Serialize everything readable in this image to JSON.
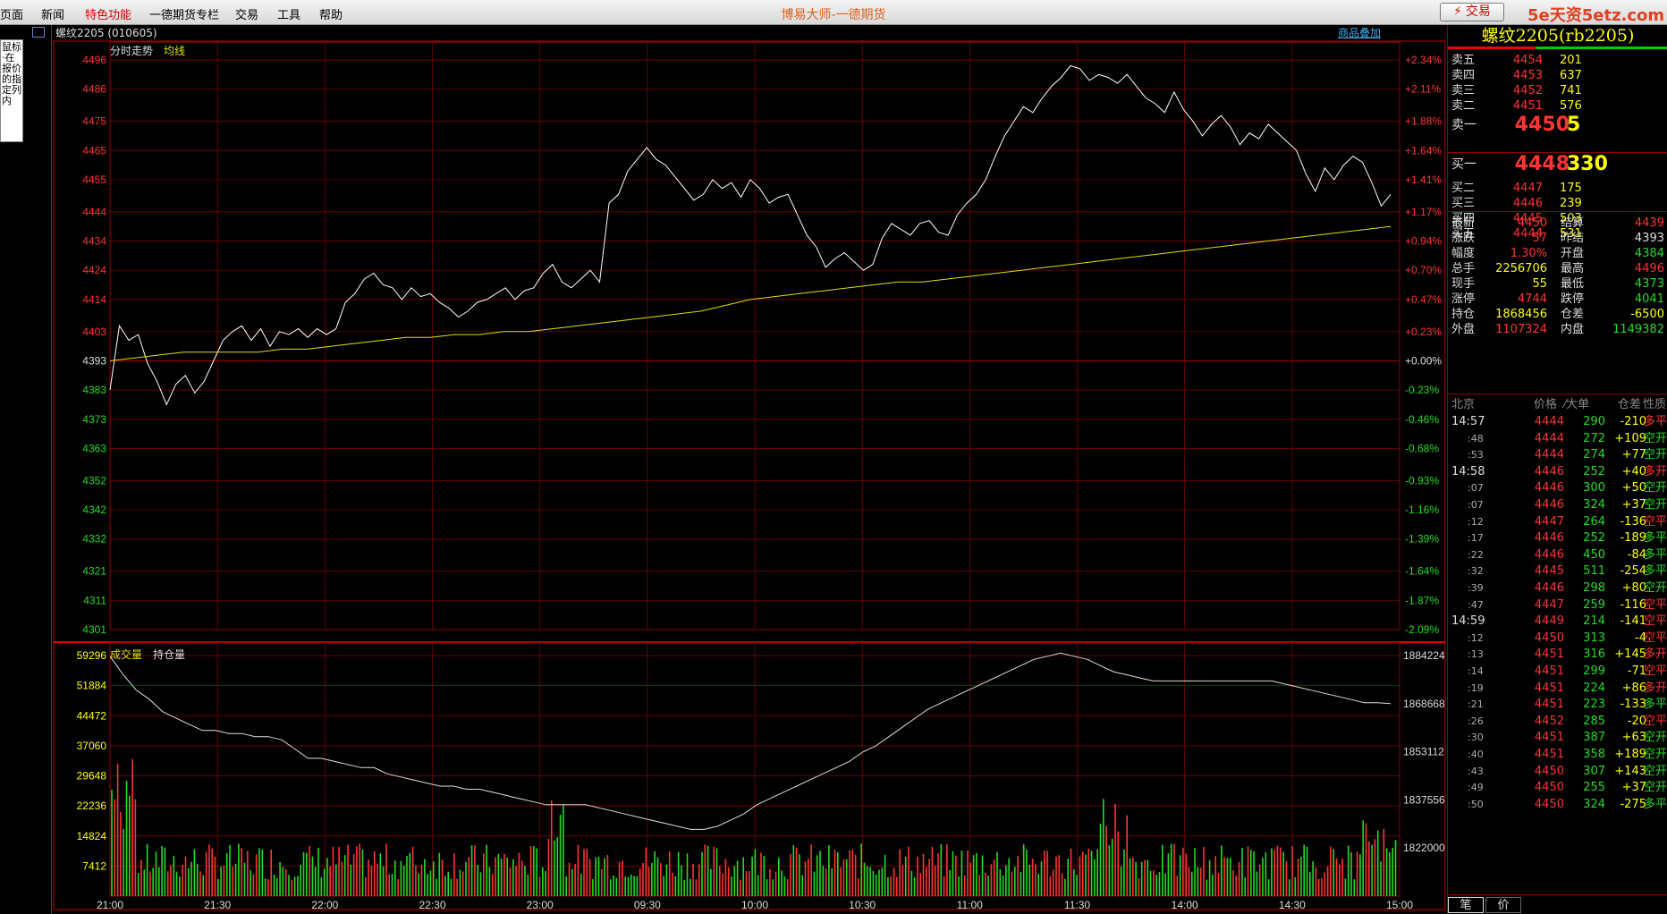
{
  "menu": [
    "页面",
    "新闻",
    "特色功能",
    "一德期货专栏",
    "交易",
    "工具",
    "帮助"
  ],
  "app_title": "博易大师-一德期货",
  "trade_button": "交易",
  "watermark": "5e天资5etz.com",
  "left_note": "鼠标·在报价的指定列内",
  "info": {
    "code": "螺纹2205 (010605)",
    "overlay_link": "商品叠加"
  },
  "upper_legend": {
    "a": "分时走势",
    "b": "均线"
  },
  "lower_legend": {
    "a": "成交量",
    "b": "持仓量"
  },
  "colors": {
    "up": "#ff3333",
    "down": "#22dd22",
    "flat": "#dddddd",
    "avg_line": "#e0e000",
    "grid": "#8a0000",
    "price_line": "#ffffff"
  },
  "chart_data": [
    {
      "type": "line",
      "title": "分时走势",
      "y_ticks": [
        4496,
        4486,
        4475,
        4465,
        4455,
        4444,
        4434,
        4424,
        4414,
        4403,
        4393,
        4383,
        4373,
        4363,
        4352,
        4342,
        4332,
        4321,
        4311,
        4301
      ],
      "pct_ticks": [
        "+2.34%",
        "+2.11%",
        "+1.88%",
        "+1.64%",
        "+1.41%",
        "+1.17%",
        "+0.94%",
        "+0.70%",
        "+0.47%",
        "+0.23%",
        "+0.00%",
        "-0.23%",
        "-0.46%",
        "-0.68%",
        "-0.93%",
        "-1.16%",
        "-1.39%",
        "-1.64%",
        "-1.87%",
        "-2.09%"
      ],
      "ylim": [
        4301,
        4496
      ],
      "base": 4393,
      "x_ticks": [
        "21:00",
        "21:30",
        "22:00",
        "22:30",
        "23:00",
        "09:30",
        "10:00",
        "10:30",
        "11:00",
        "11:30",
        "14:00",
        "14:30",
        "15:00"
      ],
      "series": [
        {
          "name": "分时走势",
          "values": [
            4383,
            4405,
            4400,
            4402,
            4392,
            4386,
            4378,
            4385,
            4388,
            4382,
            4386,
            4393,
            4400,
            4403,
            4405,
            4400,
            4404,
            4398,
            4403,
            4402,
            4404,
            4401,
            4404,
            4402,
            4404,
            4413,
            4416,
            4421,
            4423,
            4419,
            4418,
            4414,
            4418,
            4415,
            4416,
            4413,
            4411,
            4408,
            4410,
            4413,
            4414,
            4416,
            4418,
            4414,
            4417,
            4418,
            4423,
            4426,
            4420,
            4418,
            4421,
            4424,
            4420,
            4447,
            4450,
            4458,
            4462,
            4466,
            4462,
            4460,
            4456,
            4452,
            4448,
            4450,
            4455,
            4452,
            4454,
            4449,
            4455,
            4452,
            4447,
            4449,
            4450,
            4443,
            4436,
            4432,
            4425,
            4428,
            4430,
            4427,
            4424,
            4426,
            4435,
            4440,
            4438,
            4436,
            4440,
            4441,
            4437,
            4436,
            4443,
            4447,
            4450,
            4455,
            4463,
            4470,
            4475,
            4480,
            4478,
            4483,
            4487,
            4490,
            4494,
            4493,
            4489,
            4491,
            4490,
            4488,
            4491,
            4487,
            4483,
            4481,
            4478,
            4485,
            4479,
            4475,
            4470,
            4474,
            4477,
            4473,
            4467,
            4471,
            4469,
            4474,
            4471,
            4468,
            4465,
            4457,
            4451,
            4459,
            4455,
            4460,
            4463,
            4461,
            4454,
            4446,
            4450
          ]
        },
        {
          "name": "均线",
          "values": [
            4393,
            4394,
            4395,
            4396,
            4396,
            4396,
            4396,
            4397,
            4397,
            4398,
            4399,
            4400,
            4401,
            4401,
            4402,
            4402,
            4403,
            4403,
            4404,
            4405,
            4406,
            4407,
            4408,
            4409,
            4410,
            4412,
            4414,
            4415,
            4416,
            4417,
            4418,
            4419,
            4420,
            4420,
            4421,
            4422,
            4423,
            4424,
            4425,
            4426,
            4427,
            4428,
            4429,
            4430,
            4431,
            4432,
            4433,
            4434,
            4435,
            4436,
            4437,
            4438,
            4439
          ]
        }
      ]
    },
    {
      "type": "bar",
      "title": "成交量",
      "y_ticks_left": [
        59296,
        51884,
        44472,
        37060,
        29648,
        22236,
        14824,
        7412
      ],
      "y_ticks_right": [
        1884224,
        1868668,
        1853112,
        1837556,
        1822000
      ],
      "ylim_left": [
        0,
        59296
      ],
      "series": [
        {
          "name": "持仓量",
          "values": [
            1884000,
            1878000,
            1873000,
            1870000,
            1866000,
            1864000,
            1862000,
            1860000,
            1860000,
            1859000,
            1859000,
            1858000,
            1858000,
            1857000,
            1854000,
            1851000,
            1851000,
            1850000,
            1849000,
            1848000,
            1848000,
            1846000,
            1845000,
            1844000,
            1843000,
            1842000,
            1842000,
            1841000,
            1841000,
            1840000,
            1839000,
            1838000,
            1837000,
            1836000,
            1836000,
            1836000,
            1836000,
            1835000,
            1834000,
            1833000,
            1832000,
            1831000,
            1830000,
            1829000,
            1828000,
            1828000,
            1829000,
            1831000,
            1833000,
            1836000,
            1838000,
            1840000,
            1842000,
            1844000,
            1846000,
            1848000,
            1850000,
            1853000,
            1855000,
            1858000,
            1861000,
            1864000,
            1867000,
            1869000,
            1871000,
            1873000,
            1875000,
            1877000,
            1879000,
            1881000,
            1883000,
            1884000,
            1885000,
            1884000,
            1883000,
            1881000,
            1879000,
            1878000,
            1877000,
            1876000,
            1876000,
            1876000,
            1876000,
            1876000,
            1876000,
            1876000,
            1876000,
            1876000,
            1876000,
            1875000,
            1874000,
            1873000,
            1872000,
            1871000,
            1870000,
            1869000,
            1869000,
            1868668
          ]
        }
      ]
    }
  ],
  "quote": {
    "title": "螺纹2205(rb2205)",
    "asks": [
      {
        "label": "卖五",
        "price": "4454",
        "vol": "201"
      },
      {
        "label": "卖四",
        "price": "4453",
        "vol": "637"
      },
      {
        "label": "卖三",
        "price": "4452",
        "vol": "741"
      },
      {
        "label": "卖二",
        "price": "4451",
        "vol": "576"
      },
      {
        "label": "卖一",
        "price": "4450",
        "vol": "5"
      }
    ],
    "bids": [
      {
        "label": "买一",
        "price": "4448",
        "vol": "330"
      },
      {
        "label": "买二",
        "price": "4447",
        "vol": "175"
      },
      {
        "label": "买三",
        "price": "4446",
        "vol": "239"
      },
      {
        "label": "买四",
        "price": "4445",
        "vol": "503"
      },
      {
        "label": "买五",
        "price": "4444",
        "vol": "531"
      }
    ],
    "stats": [
      {
        "l1": "最新",
        "v1": "4450",
        "c1": "red",
        "l2": "结算",
        "v2": "4439",
        "c2": "red"
      },
      {
        "l1": "涨跌",
        "v1": "57",
        "c1": "red",
        "l2": "昨结",
        "v2": "4393",
        "c2": "white"
      },
      {
        "l1": "幅度",
        "v1": "1.30%",
        "c1": "red",
        "l2": "开盘",
        "v2": "4384",
        "c2": "green"
      },
      {
        "l1": "总手",
        "v1": "2256706",
        "c1": "yellow",
        "l2": "最高",
        "v2": "4496",
        "c2": "red"
      },
      {
        "l1": "现手",
        "v1": "55",
        "c1": "yellow",
        "l2": "最低",
        "v2": "4373",
        "c2": "green"
      },
      {
        "l1": "涨停",
        "v1": "4744",
        "c1": "red",
        "l2": "跌停",
        "v2": "4041",
        "c2": "green"
      },
      {
        "l1": "持仓",
        "v1": "1868456",
        "c1": "yellow",
        "l2": "仓差",
        "v2": "-6500",
        "c2": "yellow"
      },
      {
        "l1": "外盘",
        "v1": "1107324",
        "c1": "red",
        "l2": "内盘",
        "v2": "1149382",
        "c2": "green"
      }
    ],
    "tick_header": {
      "time": "北京",
      "price": "价格",
      "vol": "⁄大单",
      "oi": "仓差",
      "type": "性质"
    },
    "ticks": [
      {
        "t": "14:57",
        "sub": false,
        "p": "4444",
        "v": "290",
        "oi": "-210",
        "type": "多平",
        "tc": "red"
      },
      {
        "t": ":48",
        "sub": true,
        "p": "4444",
        "v": "272",
        "oi": "+109",
        "type": "空开",
        "tc": "green"
      },
      {
        "t": ":53",
        "sub": true,
        "p": "4444",
        "v": "274",
        "oi": "+77",
        "type": "空开",
        "tc": "green"
      },
      {
        "t": "14:58",
        "sub": false,
        "p": "4446",
        "v": "252",
        "oi": "+40",
        "type": "多开",
        "tc": "red"
      },
      {
        "t": ":07",
        "sub": true,
        "p": "4446",
        "v": "300",
        "oi": "+50",
        "type": "空开",
        "tc": "green"
      },
      {
        "t": ":07",
        "sub": true,
        "p": "4446",
        "v": "324",
        "oi": "+37",
        "type": "空开",
        "tc": "green"
      },
      {
        "t": ":12",
        "sub": true,
        "p": "4447",
        "v": "264",
        "oi": "-136",
        "type": "空平",
        "tc": "red"
      },
      {
        "t": ":17",
        "sub": true,
        "p": "4446",
        "v": "252",
        "oi": "-189",
        "type": "多平",
        "tc": "green"
      },
      {
        "t": ":22",
        "sub": true,
        "p": "4446",
        "v": "450",
        "oi": "-84",
        "type": "多平",
        "tc": "green"
      },
      {
        "t": ":32",
        "sub": true,
        "p": "4445",
        "v": "511",
        "oi": "-254",
        "type": "多平",
        "tc": "green"
      },
      {
        "t": ":39",
        "sub": true,
        "p": "4446",
        "v": "298",
        "oi": "+80",
        "type": "空开",
        "tc": "green"
      },
      {
        "t": ":47",
        "sub": true,
        "p": "4447",
        "v": "259",
        "oi": "-116",
        "type": "空平",
        "tc": "red"
      },
      {
        "t": "14:59",
        "sub": false,
        "p": "4449",
        "v": "214",
        "oi": "-141",
        "type": "空平",
        "tc": "red"
      },
      {
        "t": ":12",
        "sub": true,
        "p": "4450",
        "v": "313",
        "oi": "-4",
        "type": "空平",
        "tc": "red"
      },
      {
        "t": ":13",
        "sub": true,
        "p": "4451",
        "v": "316",
        "oi": "+145",
        "type": "多开",
        "tc": "red"
      },
      {
        "t": ":14",
        "sub": true,
        "p": "4451",
        "v": "299",
        "oi": "-71",
        "type": "空平",
        "tc": "red"
      },
      {
        "t": ":19",
        "sub": true,
        "p": "4451",
        "v": "224",
        "oi": "+86",
        "type": "多开",
        "tc": "red"
      },
      {
        "t": ":21",
        "sub": true,
        "p": "4451",
        "v": "223",
        "oi": "-133",
        "type": "多平",
        "tc": "green"
      },
      {
        "t": ":26",
        "sub": true,
        "p": "4452",
        "v": "285",
        "oi": "-20",
        "type": "空平",
        "tc": "red"
      },
      {
        "t": ":30",
        "sub": true,
        "p": "4451",
        "v": "387",
        "oi": "+63",
        "type": "空开",
        "tc": "green"
      },
      {
        "t": ":40",
        "sub": true,
        "p": "4451",
        "v": "358",
        "oi": "+189",
        "type": "空开",
        "tc": "green"
      },
      {
        "t": ":43",
        "sub": true,
        "p": "4450",
        "v": "307",
        "oi": "+143",
        "type": "空开",
        "tc": "green"
      },
      {
        "t": ":49",
        "sub": true,
        "p": "4450",
        "v": "255",
        "oi": "+37",
        "type": "空开",
        "tc": "green"
      },
      {
        "t": ":50",
        "sub": true,
        "p": "4450",
        "v": "324",
        "oi": "-275",
        "type": "多平",
        "tc": "green"
      }
    ],
    "tabs": [
      "笔",
      "价"
    ]
  }
}
